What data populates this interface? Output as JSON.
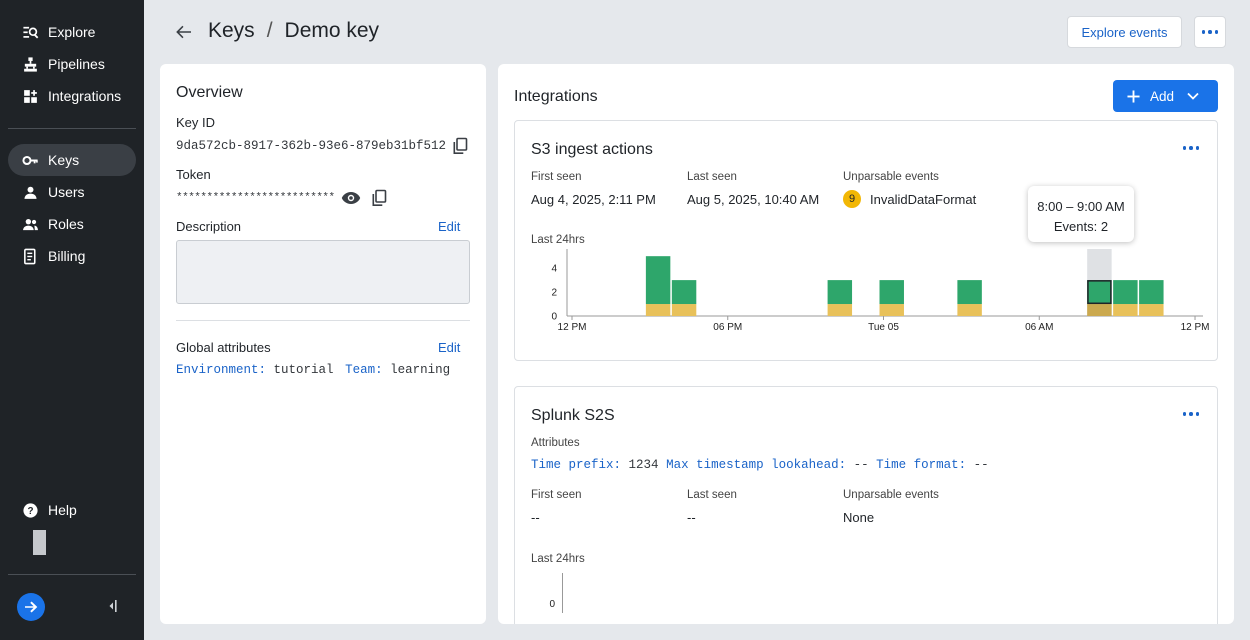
{
  "sidebar": {
    "items_top": [
      {
        "label": "Explore",
        "icon": "explore-icon"
      },
      {
        "label": "Pipelines",
        "icon": "pipelines-icon"
      },
      {
        "label": "Integrations",
        "icon": "integrations-icon"
      }
    ],
    "items_mid": [
      {
        "label": "Keys",
        "icon": "key-icon",
        "active": true
      },
      {
        "label": "Users",
        "icon": "user-icon"
      },
      {
        "label": "Roles",
        "icon": "roles-icon"
      },
      {
        "label": "Billing",
        "icon": "billing-icon"
      }
    ],
    "help_label": "Help"
  },
  "header": {
    "crumb_parent": "Keys",
    "crumb_sep": "/",
    "crumb_current": "Demo key",
    "explore_events_label": "Explore events"
  },
  "overview": {
    "title": "Overview",
    "key_id_label": "Key ID",
    "key_id_value": "9da572cb-8917-362b-93e6-879eb31bf512",
    "token_label": "Token",
    "token_value": "**************************",
    "description_label": "Description",
    "description_edit": "Edit",
    "global_attrs_label": "Global attributes",
    "global_attrs_edit": "Edit",
    "attrs": [
      {
        "key": "Environment:",
        "value": "tutorial"
      },
      {
        "key": "Team:",
        "value": "learning"
      }
    ]
  },
  "integrations": {
    "title": "Integrations",
    "add_label": "Add",
    "s3": {
      "title": "S3 ingest actions",
      "first_seen_label": "First seen",
      "first_seen_value": "Aug 4, 2025, 2:11 PM",
      "last_seen_label": "Last seen",
      "last_seen_value": "Aug 5, 2025, 10:40 AM",
      "unparsable_label": "Unparsable events",
      "unparsable_count": "9",
      "unparsable_value": "InvalidDataFormat",
      "chart_label": "Last 24hrs",
      "tooltip_time": "8:00 – 9:00 AM",
      "tooltip_events": "Events: 2"
    },
    "splunk": {
      "title": "Splunk S2S",
      "attributes_label": "Attributes",
      "attrs": [
        {
          "key": "Time prefix:",
          "value": "1234"
        },
        {
          "key": "Max timestamp lookahead:",
          "value": "--"
        },
        {
          "key": "Time format:",
          "value": "--"
        }
      ],
      "first_seen_label": "First seen",
      "first_seen_value": "--",
      "last_seen_label": "Last seen",
      "last_seen_value": "--",
      "unparsable_label": "Unparsable events",
      "unparsable_value": "None",
      "chart_label": "Last 24hrs",
      "chart_ytick": "0"
    }
  },
  "colors": {
    "accent": "#1a73e8",
    "sidebar_bg": "#1f2327",
    "bar_green": "#2ea66b",
    "bar_yellow": "#e8c15a",
    "badge": "#f2b705"
  },
  "chart_data": {
    "type": "bar",
    "stacked": true,
    "categories": [
      "12 PM",
      "1 PM",
      "2 PM",
      "3 PM",
      "4 PM",
      "5 PM",
      "6 PM",
      "7 PM",
      "8 PM",
      "9 PM",
      "10 PM",
      "11 PM",
      "Tue 05",
      "1 AM",
      "2 AM",
      "3 AM",
      "4 AM",
      "5 AM",
      "6 AM",
      "7 AM",
      "8 AM",
      "9 AM",
      "10 AM",
      "11 AM"
    ],
    "series": [
      {
        "values": [
          0,
          0,
          0,
          1,
          1,
          0,
          0,
          0,
          0,
          0,
          1,
          0,
          1,
          0,
          0,
          1,
          0,
          0,
          0,
          0,
          1,
          1,
          1,
          0
        ]
      },
      {
        "values": [
          0,
          0,
          0,
          4,
          2,
          0,
          0,
          0,
          0,
          0,
          2,
          0,
          2,
          0,
          0,
          2,
          0,
          0,
          0,
          0,
          2,
          2,
          2,
          0
        ]
      }
    ],
    "xticks": [
      "12 PM",
      "06 PM",
      "Tue 05",
      "06 AM",
      "12 PM"
    ],
    "yticks": [
      0,
      2,
      4
    ],
    "ylim": [
      0,
      5.6
    ],
    "highlight_index": 20
  }
}
